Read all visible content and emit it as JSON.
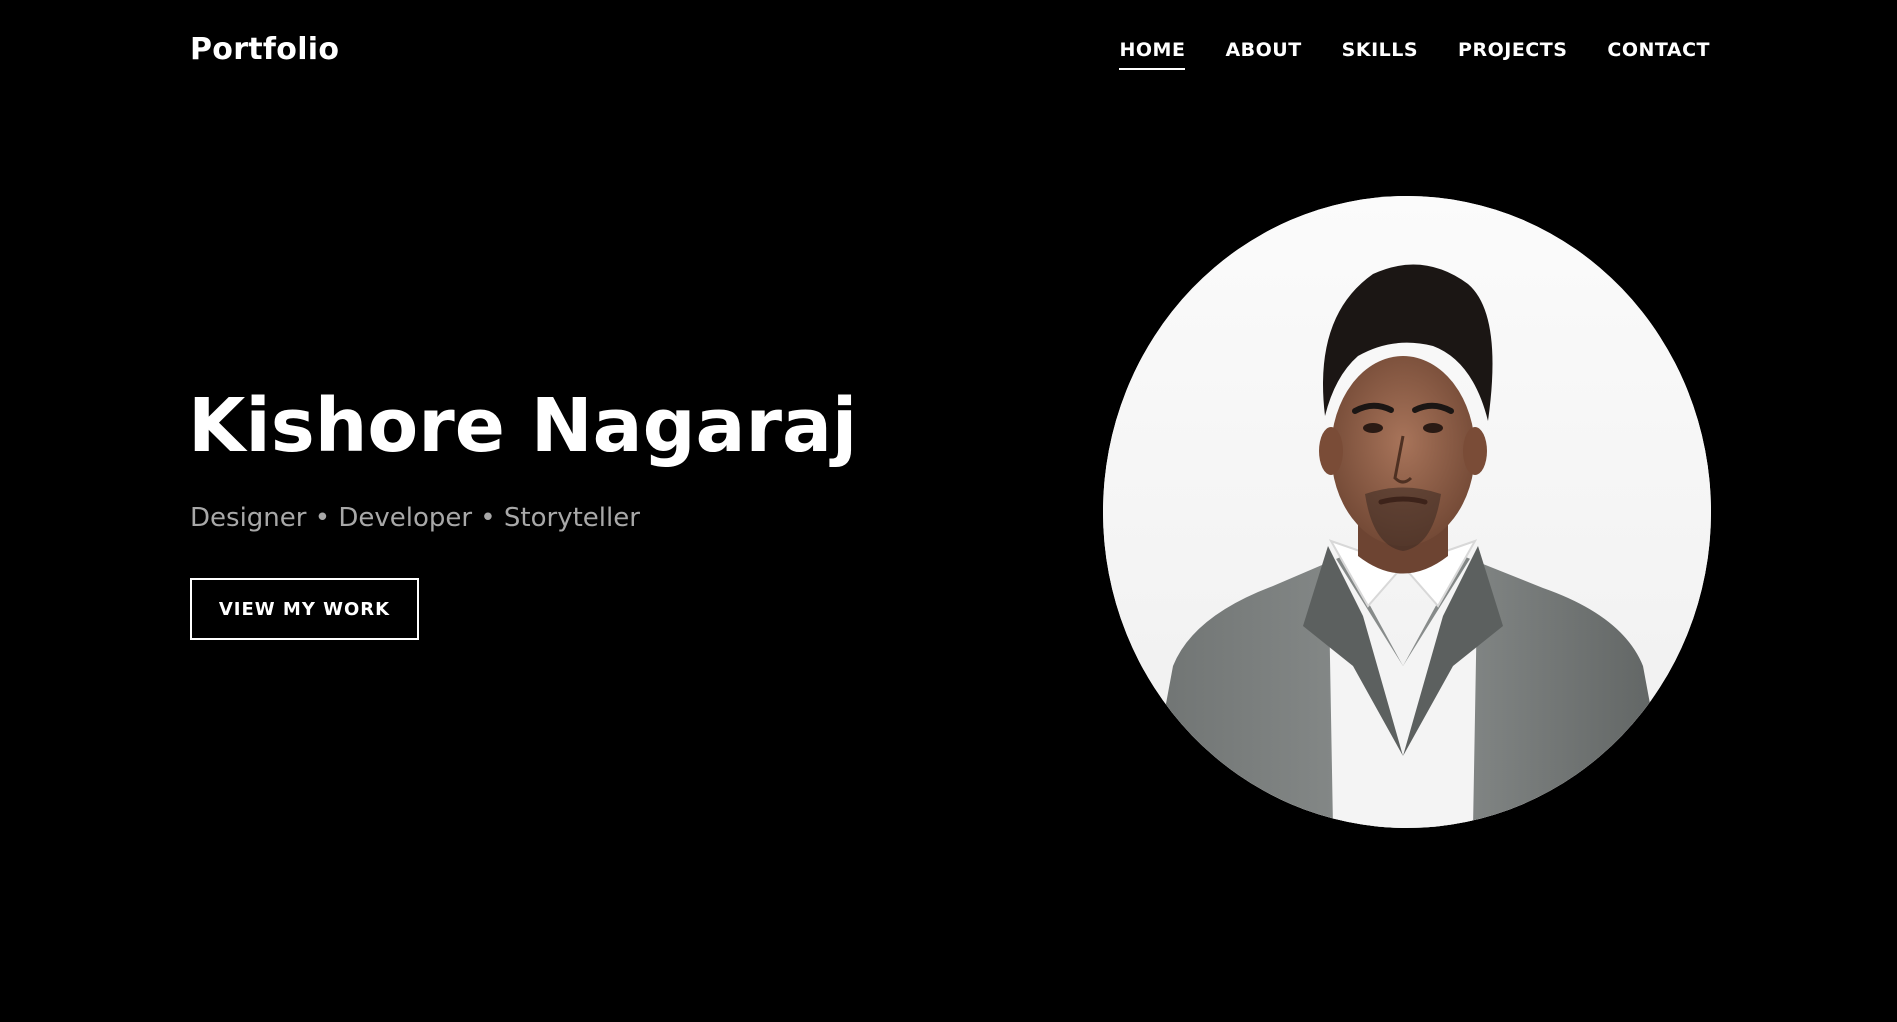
{
  "header": {
    "brand": "Portfolio",
    "nav": [
      {
        "label": "HOME",
        "active": true
      },
      {
        "label": "ABOUT",
        "active": false
      },
      {
        "label": "SKILLS",
        "active": false
      },
      {
        "label": "PROJECTS",
        "active": false
      },
      {
        "label": "CONTACT",
        "active": false
      }
    ]
  },
  "hero": {
    "name": "Kishore Nagaraj",
    "tagline": "Designer • Developer • Storyteller",
    "cta_label": "VIEW MY WORK"
  },
  "avatar": {
    "icon": "profile-photo"
  },
  "colors": {
    "background": "#000000",
    "text": "#ffffff",
    "tagline": "#a8a8a8"
  }
}
